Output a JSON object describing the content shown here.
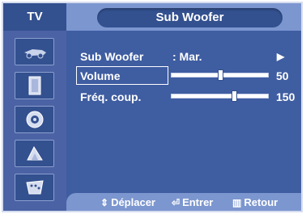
{
  "header": {
    "tv_label": "TV",
    "title": "Sub Woofer"
  },
  "sidebar": {
    "items": [
      {
        "icon": "picture-icon"
      },
      {
        "icon": "sound-icon"
      },
      {
        "icon": "channel-icon"
      },
      {
        "icon": "setup-icon"
      },
      {
        "icon": "input-icon"
      }
    ]
  },
  "menu": {
    "sub_woofer": {
      "label": "Sub Woofer",
      "value": ": Mar.",
      "arrow": "▶"
    },
    "volume": {
      "label": "Volume",
      "value": "50",
      "level": 0.5
    },
    "freq": {
      "label": "Fréq. coup.",
      "value": "150",
      "level": 0.65
    }
  },
  "footer": {
    "move_icon": "⇕",
    "move_label": "Déplacer",
    "enter_icon": "⏎",
    "enter_label": "Entrer",
    "return_icon": "▥",
    "return_label": "Retour"
  },
  "colors": {
    "background": "#3f5da1",
    "header": "#7c96cf",
    "dark": "#33508f"
  }
}
